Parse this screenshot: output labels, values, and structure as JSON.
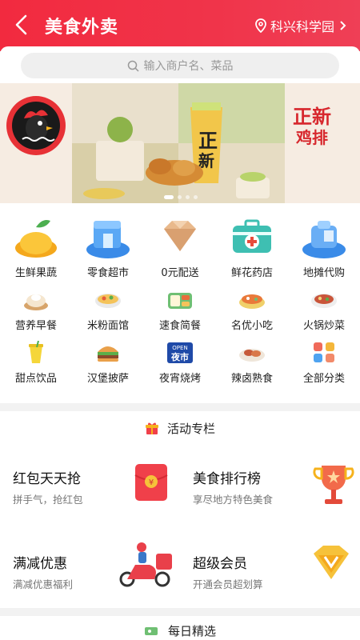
{
  "header": {
    "title": "美食外卖",
    "location": "科兴科学园"
  },
  "search": {
    "placeholder": "输入商户名、菜品"
  },
  "banner": {
    "brand_line1": "正新",
    "brand_line2": "鸡排"
  },
  "categories": [
    {
      "label": "生鲜果蔬",
      "icon": "fruit-icon"
    },
    {
      "label": "零食超市",
      "icon": "store-icon"
    },
    {
      "label": "0元配送",
      "icon": "diamond-icon"
    },
    {
      "label": "鲜花药店",
      "icon": "medkit-icon"
    },
    {
      "label": "地摊代购",
      "icon": "bag-icon"
    },
    {
      "label": "营养早餐",
      "icon": "steamer-icon"
    },
    {
      "label": "米粉面馆",
      "icon": "noodle-icon"
    },
    {
      "label": "速食简餐",
      "icon": "bento-icon"
    },
    {
      "label": "名优小吃",
      "icon": "snack-icon"
    },
    {
      "label": "火锅炒菜",
      "icon": "hotpot-icon"
    },
    {
      "label": "甜点饮品",
      "icon": "drink-icon"
    },
    {
      "label": "汉堡披萨",
      "icon": "burger-icon"
    },
    {
      "label": "夜宵烧烤",
      "icon": "night-market-icon"
    },
    {
      "label": "辣卤熟食",
      "icon": "braised-icon"
    },
    {
      "label": "全部分类",
      "icon": "all-categories-icon"
    }
  ],
  "night_badge": {
    "top": "OPEN",
    "bottom": "夜市"
  },
  "activity": {
    "title": "活动专栏",
    "promos": [
      {
        "title": "红包天天抢",
        "subtitle": "拼手气，抢红包",
        "icon": "red-envelope-icon"
      },
      {
        "title": "美食排行榜",
        "subtitle": "享尽地方特色美食",
        "icon": "trophy-icon"
      },
      {
        "title": "满减优惠",
        "subtitle": "满减优惠福利",
        "icon": "scooter-icon"
      },
      {
        "title": "超级会员",
        "subtitle": "开通会员超划算",
        "icon": "vip-icon"
      }
    ]
  },
  "daily": {
    "title": "每日精选"
  },
  "colors": {
    "primary": "#f22a3f",
    "text": "#222222",
    "muted": "#777777"
  }
}
